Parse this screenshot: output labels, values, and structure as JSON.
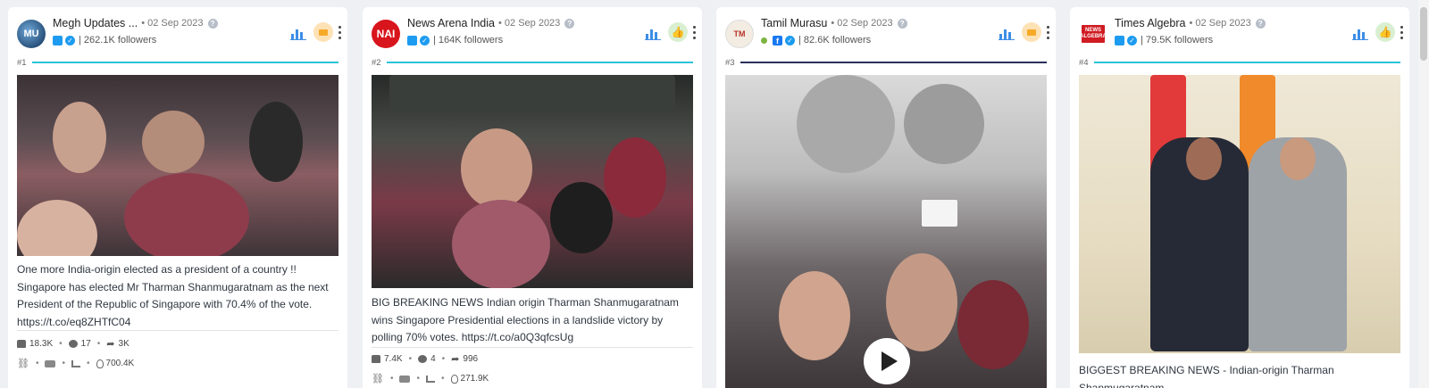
{
  "cards": [
    {
      "author": "Megh Updates ...",
      "avatar_text": "MU",
      "date": "02 Sep 2023",
      "followers": "262.1K followers",
      "rank": "#1",
      "text": "One more India-origin elected as a president of a country !! Singapore has elected Mr Tharman Shanmugaratnam as the next President of the Republic of Singapore with 70.4% of the vote. https://t.co/eq8ZHTfC04",
      "likes": "18.3K",
      "comments": "17",
      "shares": "3K",
      "reach": "700.4K"
    },
    {
      "author": "News Arena India",
      "avatar_text": "NAI",
      "date": "02 Sep 2023",
      "followers": "164K followers",
      "rank": "#2",
      "text": "BIG BREAKING NEWS Indian origin Tharman Shanmugaratnam wins Singapore Presidential elections in a landslide victory by polling 70% votes. https://t.co/a0Q3qfcsUg",
      "likes": "7.4K",
      "comments": "4",
      "shares": "996",
      "reach": "271.9K"
    },
    {
      "author": "Tamil Murasu",
      "avatar_text": "TM",
      "date": "02 Sep 2023",
      "followers": "82.6K followers",
      "rank": "#3",
      "facebook_glyph": "f"
    },
    {
      "author": "Times Algebra",
      "avatar_text": "NEWS ALGEBRA",
      "date": "02 Sep 2023",
      "followers": "79.5K followers",
      "rank": "#4",
      "text": "BIGGEST BREAKING NEWS - Indian-origin Tharman Shanmugaratnam"
    }
  ],
  "icons": {
    "help": "?",
    "verified": "✓",
    "thumbs_up": "👍",
    "share": "➦",
    "link": "🔗"
  },
  "colors": {
    "rank_line": "#2ac4d8",
    "rank_line_dark": "#2a2f5a",
    "twitter": "#1d9bf0",
    "facebook": "#1877f2",
    "sentiment_neutral": "#f7a928",
    "sentiment_positive": "#5da84a"
  }
}
